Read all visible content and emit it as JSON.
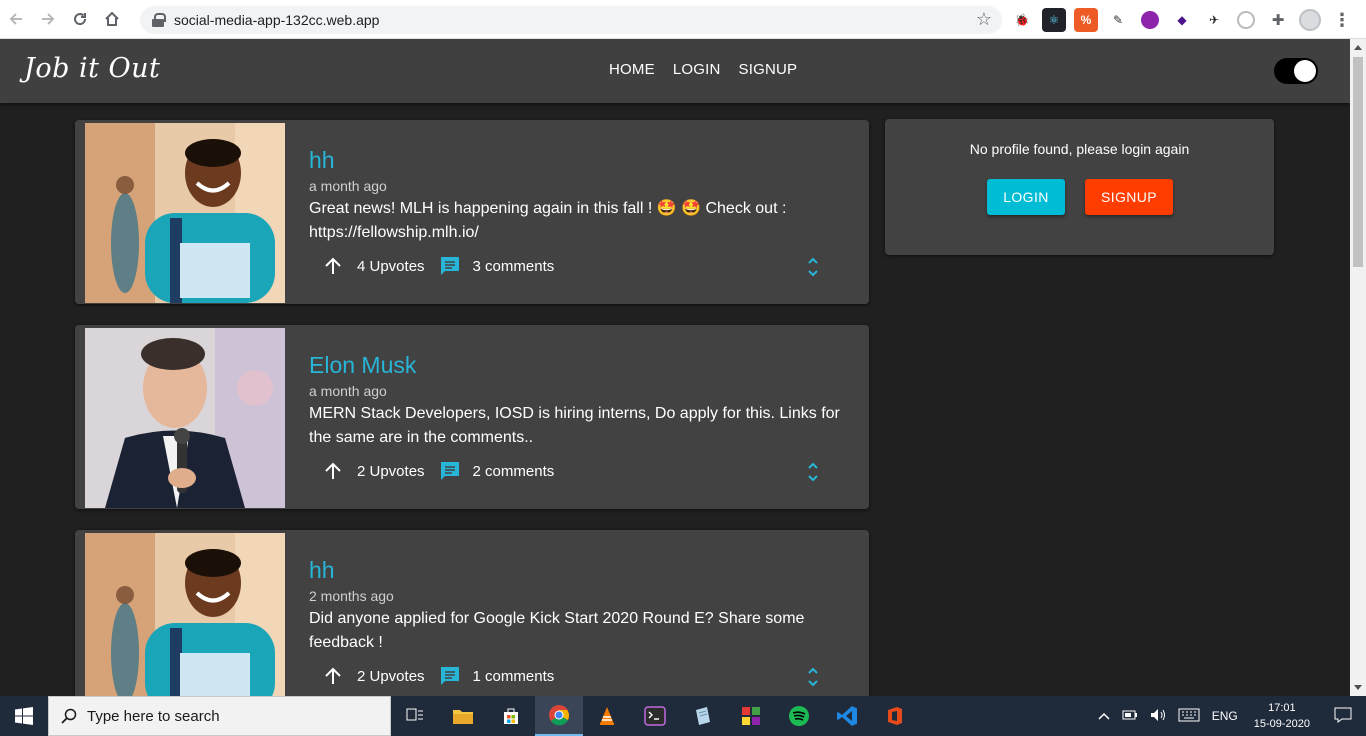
{
  "browser": {
    "url": "social-media-app-132cc.web.app"
  },
  "app": {
    "logo": "Job it Out",
    "menu": [
      "HOME",
      "LOGIN",
      "SIGNUP"
    ]
  },
  "posts": [
    {
      "author": "hh",
      "time": "a month ago",
      "body": "Great news! MLH is happening again in this fall ! 🤩 🤩  Check out : https://fellowship.mlh.io/",
      "upvotes": "4 Upvotes",
      "comments": "3 comments"
    },
    {
      "author": "Elon Musk",
      "time": "a month ago",
      "body": "MERN Stack Developers, IOSD is hiring interns, Do apply for this. Links for the same are in the comments..",
      "upvotes": "2 Upvotes",
      "comments": "2 comments"
    },
    {
      "author": "hh",
      "time": "2 months ago",
      "body": "Did anyone applied for Google Kick Start 2020 Round E? Share some feedback !",
      "upvotes": "2 Upvotes",
      "comments": "1 comments"
    }
  ],
  "profile": {
    "message": "No profile found, please login again",
    "login_label": "LOGIN",
    "signup_label": "SIGNUP"
  },
  "taskbar": {
    "search_placeholder": "Type here to search",
    "language": "ENG",
    "time": "17:01",
    "date": "15-09-2020"
  },
  "colors": {
    "accent": "#27b5d8",
    "login": "#00bcd4",
    "signup": "#ff3d00"
  }
}
